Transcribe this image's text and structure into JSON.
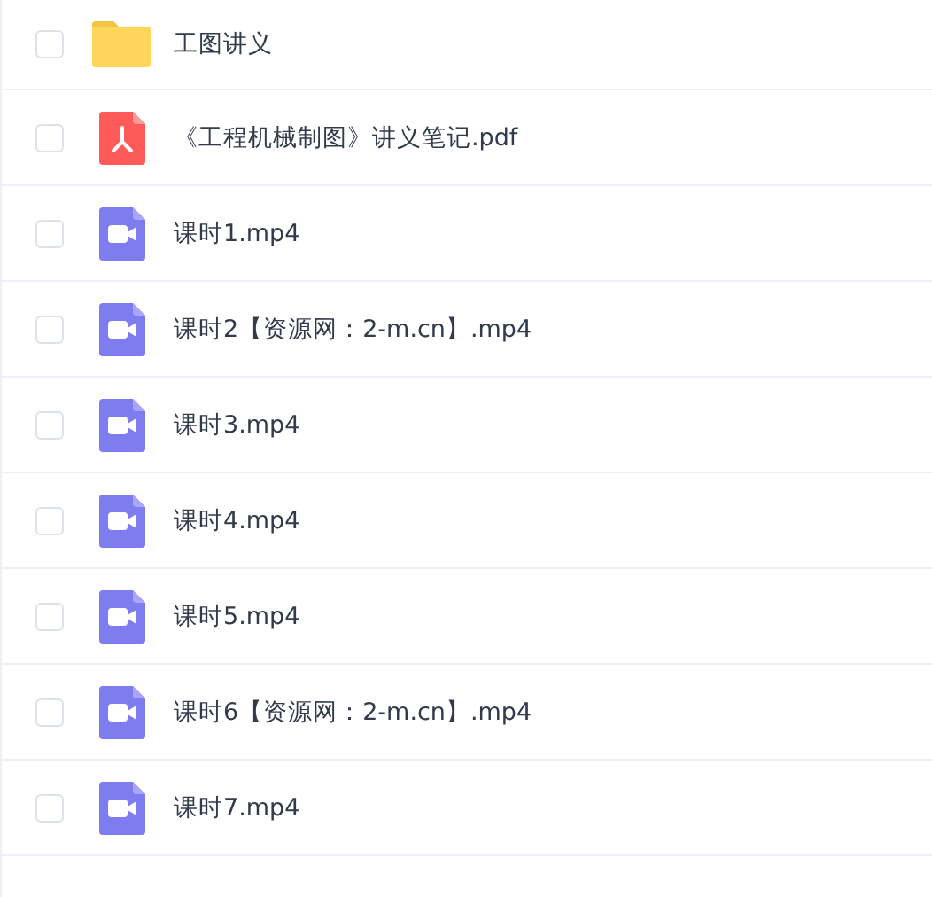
{
  "files": [
    {
      "kind": "folder",
      "name": "工图讲义",
      "checked": false
    },
    {
      "kind": "pdf",
      "name": "《工程机械制图》讲义笔记.pdf",
      "checked": false
    },
    {
      "kind": "video",
      "name": "课时1.mp4",
      "checked": false
    },
    {
      "kind": "video",
      "name": "课时2【资源网：2-m.cn】.mp4",
      "checked": false
    },
    {
      "kind": "video",
      "name": "课时3.mp4",
      "checked": false
    },
    {
      "kind": "video",
      "name": "课时4.mp4",
      "checked": false
    },
    {
      "kind": "video",
      "name": "课时5.mp4",
      "checked": false
    },
    {
      "kind": "video",
      "name": "课时6【资源网：2-m.cn】.mp4",
      "checked": false
    },
    {
      "kind": "video",
      "name": "课时7.mp4",
      "checked": false
    }
  ]
}
